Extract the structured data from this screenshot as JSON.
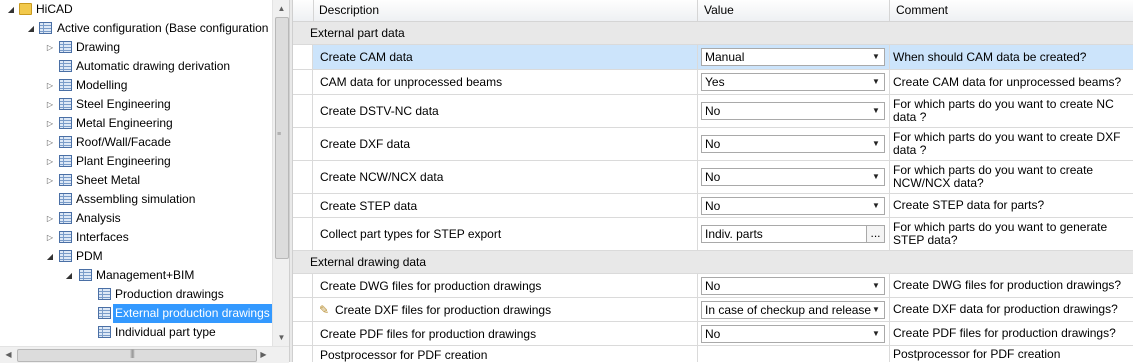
{
  "tree": {
    "root": {
      "label": "HiCAD"
    },
    "config": {
      "label": "Active configuration (Base configuration"
    },
    "items": [
      {
        "label": "Drawing"
      },
      {
        "label": "Automatic drawing derivation"
      },
      {
        "label": "Modelling"
      },
      {
        "label": "Steel Engineering"
      },
      {
        "label": "Metal Engineering"
      },
      {
        "label": "Roof/Wall/Facade"
      },
      {
        "label": "Plant Engineering"
      },
      {
        "label": "Sheet Metal"
      },
      {
        "label": "Assembling simulation"
      },
      {
        "label": "Analysis"
      },
      {
        "label": "Interfaces"
      },
      {
        "label": "PDM"
      }
    ],
    "pdm_child": {
      "label": "Management+BIM"
    },
    "mgmt_children": [
      {
        "label": "Production drawings"
      },
      {
        "label": "External production drawings"
      },
      {
        "label": "Individual part type"
      }
    ]
  },
  "grid": {
    "headers": {
      "description": "Description",
      "value": "Value",
      "comment": "Comment"
    },
    "sections": [
      {
        "label": "External part data"
      },
      {
        "label": "External drawing data"
      }
    ],
    "rows": [
      {
        "description": "Create CAM data",
        "value": "Manual",
        "comment": "When should CAM data be created?"
      },
      {
        "description": "CAM data for unprocessed beams",
        "value": "Yes",
        "comment": "Create CAM data for unprocessed beams?"
      },
      {
        "description": "Create DSTV-NC data",
        "value": "No",
        "comment": "For which parts do you want to create NC data ?"
      },
      {
        "description": "Create DXF data",
        "value": "No",
        "comment": "For which parts do you want to create DXF data ?"
      },
      {
        "description": "Create NCW/NCX data",
        "value": "No",
        "comment": "For which parts do you want to create NCW/NCX data?"
      },
      {
        "description": "Create STEP data",
        "value": "No",
        "comment": "Create STEP data for parts?"
      },
      {
        "description": "Collect part types for STEP export",
        "value": "Indiv. parts",
        "button": "...",
        "comment": "For which parts do you want to generate STEP data?"
      },
      {
        "description": "Create DWG files for production drawings",
        "value": "No",
        "comment": "Create DWG files for production drawings?"
      },
      {
        "description": "Create DXF files for production drawings",
        "value": "In case of checkup and release",
        "comment": "Create DXF data for production drawings?"
      },
      {
        "description": "Create PDF files for production drawings",
        "value": "No",
        "comment": "Create PDF files for production drawings?"
      },
      {
        "description": "Postprocessor for PDF creation",
        "value": "",
        "comment": "Postprocessor for PDF creation"
      }
    ]
  }
}
